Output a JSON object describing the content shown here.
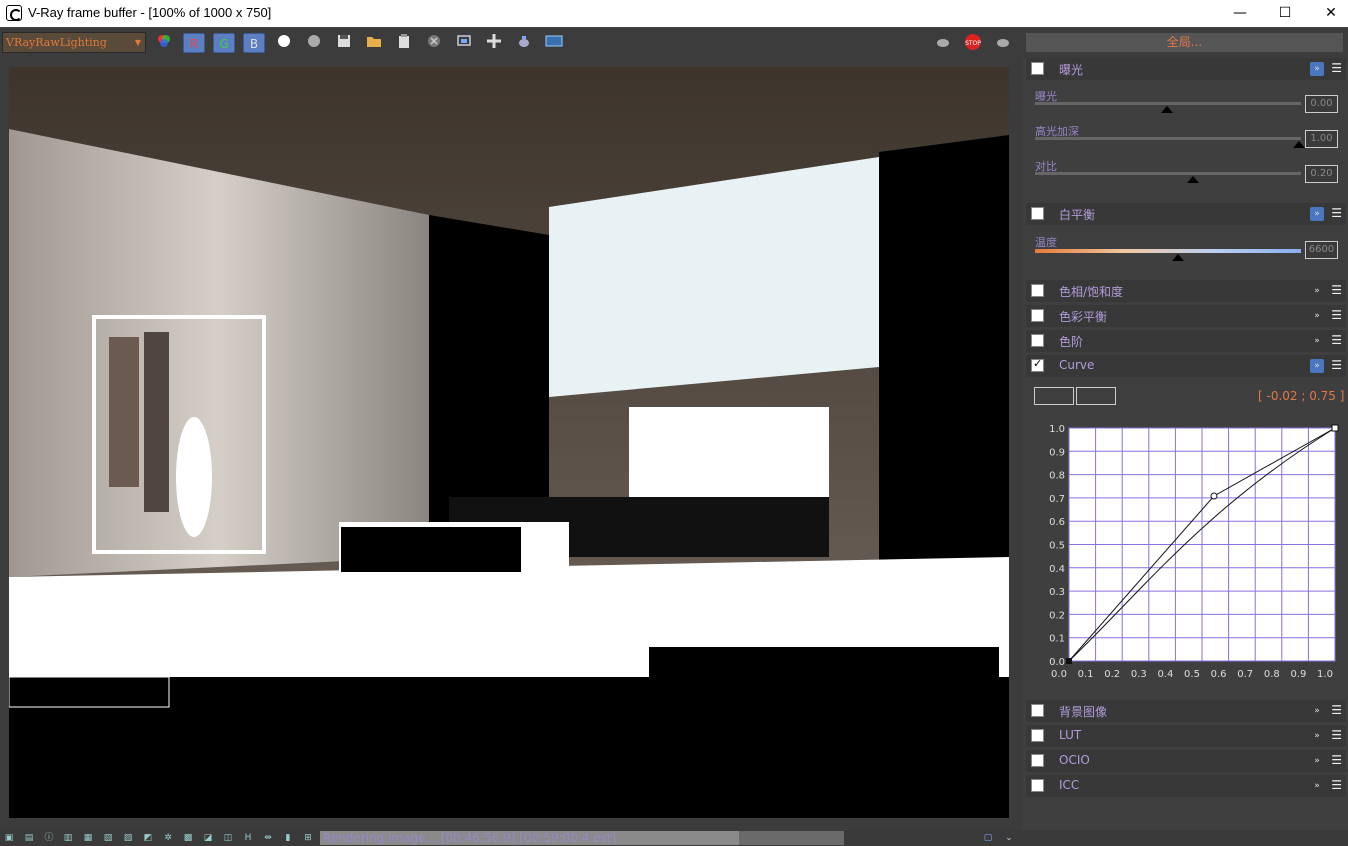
{
  "window": {
    "title": "V-Ray frame buffer - [100% of 1000 x 750]",
    "minimize": "—",
    "maximize": "☐",
    "close": "✕"
  },
  "toolbar": {
    "channel": "VRayRawLighting",
    "r": "R",
    "g": "G",
    "b": "B",
    "global_label": "全局...",
    "icons": [
      "color-mode-icon",
      "white-circle-icon",
      "gray-circle-icon",
      "save-icon",
      "open-folder-icon",
      "clipboard-icon",
      "clear-icon",
      "region-render-icon",
      "follow-mouse-icon",
      "teapot-render-icon",
      "lens-fx-icon",
      "teapot-left-icon",
      "stop-icon",
      "teapot-right-icon"
    ]
  },
  "panel": {
    "exposure": {
      "title": "曝光",
      "s1": "曝光",
      "v1": "0.00",
      "s2": "高光加深",
      "v2": "1.00",
      "s3": "对比",
      "v3": "0.20"
    },
    "wb": {
      "title": "白平衡",
      "s1": "温度",
      "v1": "6600"
    },
    "hue": "色相/饱和度",
    "balance": "色彩平衡",
    "levels": "色阶",
    "curve": {
      "title": "Curve",
      "coord": "[ -0.02 ; 0.75 ]",
      "yticks": [
        "1.0",
        "0.9",
        "0.8",
        "0.7",
        "0.6",
        "0.5",
        "0.4",
        "0.3",
        "0.2",
        "0.1",
        "0.0"
      ],
      "xticks": [
        "0.0",
        "0.1",
        "0.2",
        "0.3",
        "0.4",
        "0.5",
        "0.6",
        "0.7",
        "0.8",
        "0.9",
        "1.0"
      ]
    },
    "bg": "背景图像",
    "lut": "LUT",
    "ocio": "OCIO",
    "icc": "ICC"
  },
  "status": {
    "text": "Rendering image... [00:46:56.9] [00:59:00.4 est]",
    "progress": 0.8
  }
}
